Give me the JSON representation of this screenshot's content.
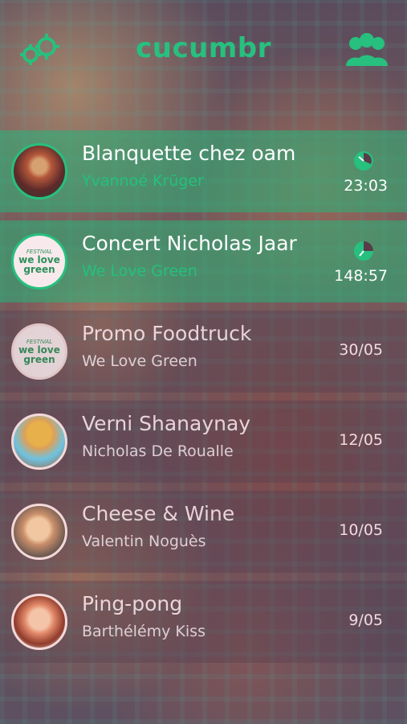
{
  "app": {
    "title": "cucumbr",
    "accent": "#27c07e"
  },
  "header": {
    "left_icon": "settings-gear-icon",
    "right_icon": "people-group-icon"
  },
  "events": [
    {
      "title": "Blanquette chez oam",
      "subtitle": "Yvannoé Krüger",
      "meta": "23:03",
      "active": true,
      "avatar": "portrait-painting-avatar",
      "meta_icon": "clock-icon"
    },
    {
      "title": "Concert Nicholas Jaar",
      "subtitle": "We Love Green",
      "meta": "148:57",
      "active": true,
      "avatar": "we-love-green-logo-avatar",
      "meta_icon": "clock-icon"
    },
    {
      "title": "Promo Foodtruck",
      "subtitle": "We Love Green",
      "meta": "30/05",
      "active": false,
      "avatar": "we-love-green-logo-avatar"
    },
    {
      "title": "Verni Shanaynay",
      "subtitle": "Nicholas De Roualle",
      "meta": "12/05",
      "active": false,
      "avatar": "hat-sunglasses-avatar"
    },
    {
      "title": "Cheese & Wine",
      "subtitle": "Valentin Noguès",
      "meta": "10/05",
      "active": false,
      "avatar": "young-man-avatar"
    },
    {
      "title": "Ping-pong",
      "subtitle": "Barthélémy Kiss",
      "meta": "9/05",
      "active": false,
      "avatar": "surprised-man-avatar"
    }
  ],
  "logo_text": {
    "line1": "we love",
    "line2": "green",
    "tag": "FESTIVAL"
  }
}
